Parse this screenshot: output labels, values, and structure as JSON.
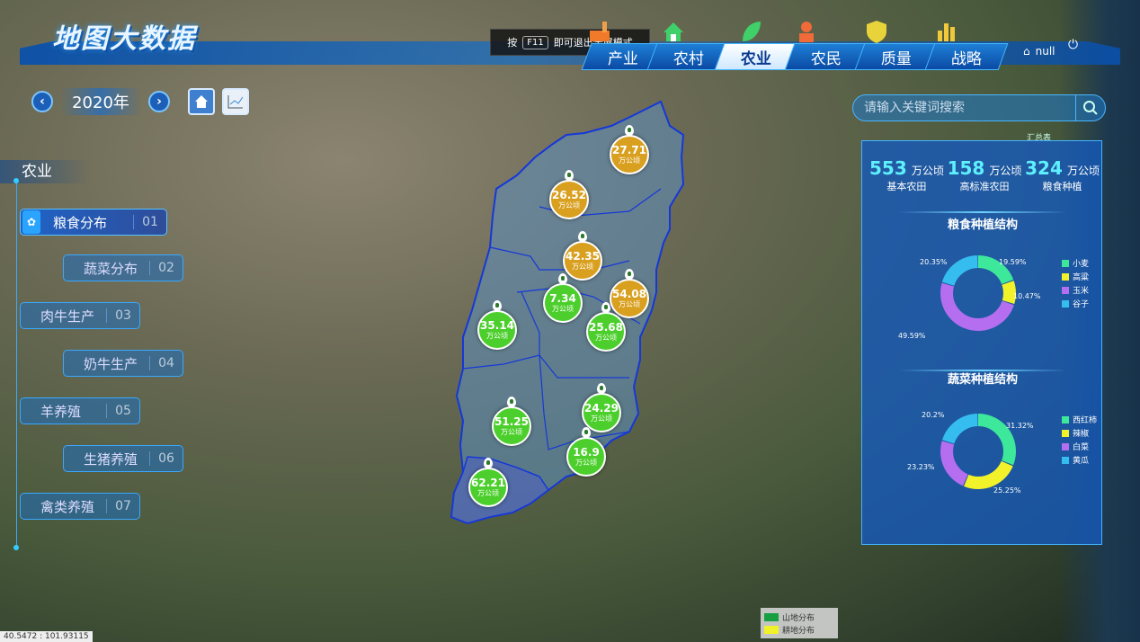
{
  "app": {
    "logo": "地图大数据"
  },
  "f11_tip": {
    "prefix": "按",
    "key": "F11",
    "suffix": "即可退出全屏模式"
  },
  "nav": {
    "tabs": [
      {
        "label": "产业",
        "active": false,
        "icon": "factory-icon"
      },
      {
        "label": "农村",
        "active": false,
        "icon": "house-icon"
      },
      {
        "label": "农业",
        "active": true,
        "icon": "leaf-icon"
      },
      {
        "label": "农民",
        "active": false,
        "icon": "farmer-icon"
      },
      {
        "label": "质量",
        "active": false,
        "icon": "shield-icon"
      },
      {
        "label": "战略",
        "active": false,
        "icon": "bar-chart-icon"
      }
    ],
    "user": "null"
  },
  "year": {
    "value": "2020年"
  },
  "sidebar": {
    "title": "农业",
    "items": [
      {
        "label": "粮食分布",
        "num": "01",
        "active": true
      },
      {
        "label": "蔬菜分布",
        "num": "02",
        "active": false
      },
      {
        "label": "肉牛生产",
        "num": "03",
        "active": false
      },
      {
        "label": "奶牛生产",
        "num": "04",
        "active": false
      },
      {
        "label": "羊养殖",
        "num": "05",
        "active": false
      },
      {
        "label": "生猪养殖",
        "num": "06",
        "active": false
      },
      {
        "label": "禽类养殖",
        "num": "07",
        "active": false
      }
    ]
  },
  "map": {
    "unit": "万公顷",
    "bubbles": [
      {
        "value": "27.71",
        "color": "orange"
      },
      {
        "value": "26.52",
        "color": "orange"
      },
      {
        "value": "42.35",
        "color": "orange"
      },
      {
        "value": "54.08",
        "color": "orange"
      },
      {
        "value": "7.34",
        "color": "green"
      },
      {
        "value": "35.14",
        "color": "green"
      },
      {
        "value": "25.68",
        "color": "green"
      },
      {
        "value": "24.29",
        "color": "green"
      },
      {
        "value": "51.25",
        "color": "green"
      },
      {
        "value": "16.9",
        "color": "green"
      },
      {
        "value": "62.21",
        "color": "green"
      }
    ],
    "colors": {
      "province_fill": "#5d8fbf",
      "province_stroke": "#1538d8",
      "south_fill": "#5060c0"
    }
  },
  "search": {
    "placeholder": "请输入关键词搜索"
  },
  "panel": {
    "tag": "汇总表",
    "stats": [
      {
        "value": "553",
        "unit": "万公顷",
        "caption": "基本农田"
      },
      {
        "value": "158",
        "unit": "万公顷",
        "caption": "高标准农田"
      },
      {
        "value": "324",
        "unit": "万公顷",
        "caption": "粮食种植"
      }
    ],
    "grain": {
      "title": "粮食种植结构",
      "slices": [
        {
          "name": "小麦",
          "pct": 19.59,
          "label": "19.59%",
          "color": "#3ee89a"
        },
        {
          "name": "高粱",
          "pct": 10.47,
          "label": "10.47%",
          "color": "#f2f22a"
        },
        {
          "name": "玉米",
          "pct": 49.59,
          "label": "49.59%",
          "color": "#b56ef0"
        },
        {
          "name": "谷子",
          "pct": 20.35,
          "label": "20.35%",
          "color": "#35bdf0"
        }
      ]
    },
    "veg": {
      "title": "蔬菜种植结构",
      "slices": [
        {
          "name": "西红柿",
          "pct": 31.32,
          "label": "31.32%",
          "color": "#3ee89a"
        },
        {
          "name": "辣椒",
          "pct": 25.25,
          "label": "25.25%",
          "color": "#f2f22a"
        },
        {
          "name": "白菜",
          "pct": 23.23,
          "label": "23.23%",
          "color": "#b56ef0"
        },
        {
          "name": "黄瓜",
          "pct": 20.2,
          "label": "20.2%",
          "color": "#35bdf0"
        }
      ]
    }
  },
  "map_legend": [
    {
      "label": "山地分布",
      "color": "#18a040"
    },
    {
      "label": "耕地分布",
      "color": "#f2f22a"
    }
  ],
  "coord": "40.5472 : 101.93115"
}
